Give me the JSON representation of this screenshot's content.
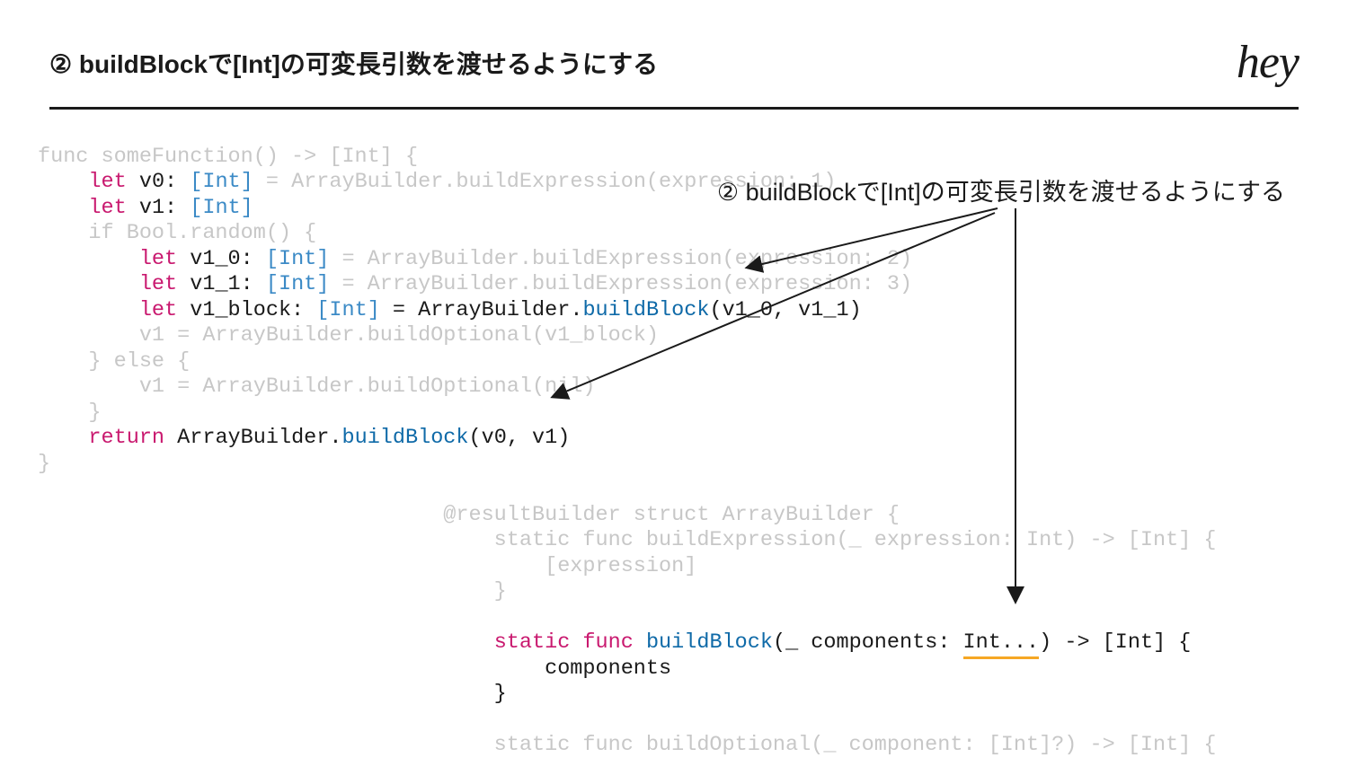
{
  "header": {
    "title": "② buildBlockで[Int]の可変長引数を渡せるようにする",
    "logo": "hey"
  },
  "annotation": "② buildBlockで[Int]の可変長引数を渡せるようにする",
  "code": {
    "l1a": "func someFunction() -> [Int] {",
    "l2a": "    ",
    "l2b": "let",
    "l2c": " v0: ",
    "l2d": "[Int]",
    "l2e": " = ArrayBuilder.buildExpression(expression: 1)",
    "l3a": "    ",
    "l3b": "let",
    "l3c": " v1: ",
    "l3d": "[Int]",
    "l4a": "    if Bool.random() {",
    "l5a": "        ",
    "l5b": "let",
    "l5c": " v1_0: ",
    "l5d": "[Int]",
    "l5e": " = ArrayBuilder.buildExpression(expression: 2)",
    "l6a": "        ",
    "l6b": "let",
    "l6c": " v1_1: ",
    "l6d": "[Int]",
    "l6e": " = ArrayBuilder.buildExpression(expression: 3)",
    "l7a": "        ",
    "l7b": "let",
    "l7c": " v1_block: ",
    "l7d": "[Int]",
    "l7e": " = ArrayBuilder.",
    "l7f": "buildBlock",
    "l7g": "(v1_0, v1_1)",
    "l8a": "        v1 = ArrayBuilder.buildOptional(v1_block)",
    "l9a": "    } else {",
    "l10a": "        v1 = ArrayBuilder.buildOptional(nil)",
    "l11a": "    }",
    "l12a": "    ",
    "l12b": "return",
    "l12c": " ArrayBuilder.",
    "l12d": "buildBlock",
    "l12e": "(v0, v1)",
    "l13a": "}",
    "b1a": "                                @resultBuilder struct ArrayBuilder {",
    "b2a": "                                    static func buildExpression(_ expression: Int) -> [Int] {",
    "b3a": "                                        [expression]",
    "b4a": "                                    }",
    "b5a": "",
    "b6a": "                                    ",
    "b6b": "static",
    "b6c": " ",
    "b6d": "func",
    "b6e": " ",
    "b6f": "buildBlock",
    "b6g": "(_ components: ",
    "b6h": "Int...",
    "b6i": ") -> [Int] {",
    "b7a": "                                        components",
    "b8a": "                                    }",
    "b9a": "",
    "b10a": "                                    static func buildOptional(_ component: [Int]?) -> [Int] {"
  }
}
